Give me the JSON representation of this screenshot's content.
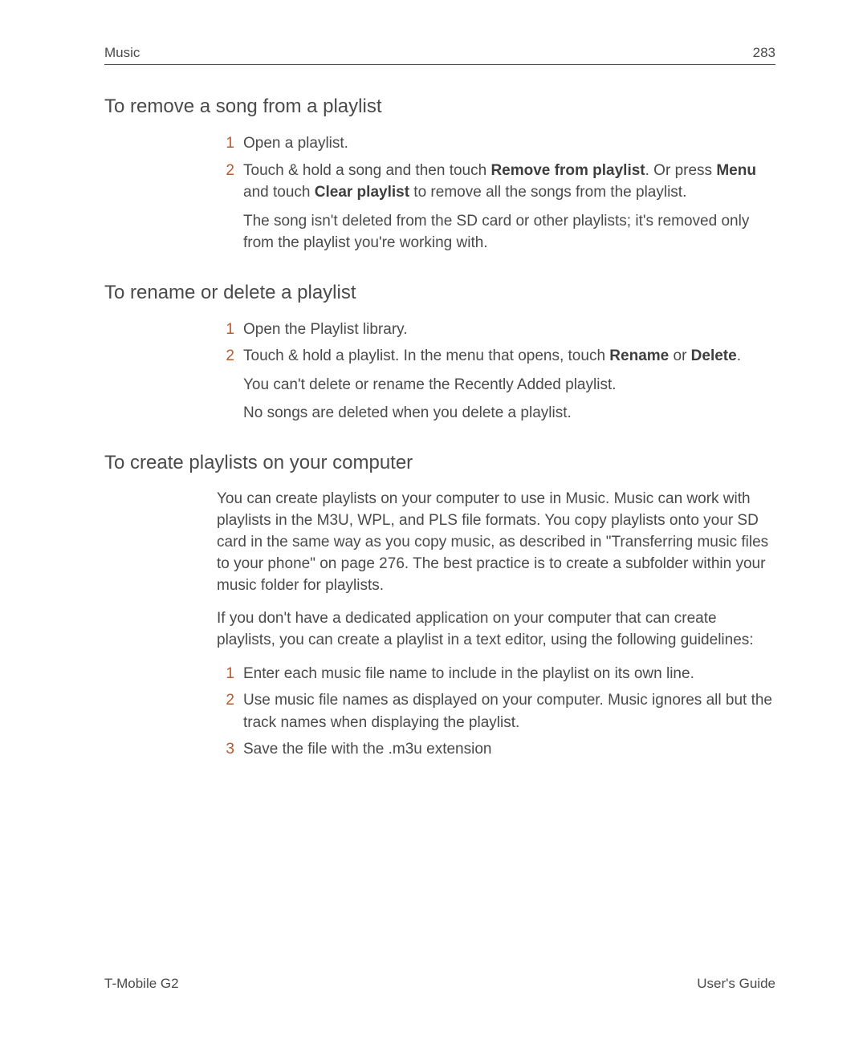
{
  "header": {
    "section": "Music",
    "page": "283"
  },
  "sections": [
    {
      "heading": "To remove a song from a playlist",
      "items": [
        {
          "num": "1",
          "html": "Open a playlist."
        },
        {
          "num": "2",
          "html": "Touch & hold a song and then touch <b>Remove from playlist</b>. Or press <b>Menu</b> and touch <b>Clear playlist</b> to remove all the songs from the playlist."
        }
      ],
      "notes": [
        "The song isn't deleted from the SD card or other playlists; it's removed only from the playlist you're working with."
      ]
    },
    {
      "heading": "To rename or delete a playlist",
      "items": [
        {
          "num": "1",
          "html": "Open the Playlist library."
        },
        {
          "num": "2",
          "html": "Touch & hold a playlist. In the menu that opens, touch <b>Rename</b> or <b>Delete</b>."
        }
      ],
      "notes": [
        "You can't delete or rename the Recently Added playlist.",
        "No songs are deleted when you delete a playlist."
      ]
    },
    {
      "heading": "To create playlists on your computer",
      "paras": [
        "You can create playlists on your computer to use in Music. Music can work with playlists in the M3U, WPL, and PLS file formats. You copy playlists onto your SD card in the same way as you copy music, as described in \"Transferring music files to your phone\" on page 276. The best practice is to create a subfolder within your music folder for playlists.",
        "If you don't have a dedicated application on your computer that can create playlists, you can create a playlist in a text editor, using the following guidelines:"
      ],
      "items": [
        {
          "num": "1",
          "html": "Enter each music file name to include in the playlist on its own line."
        },
        {
          "num": "2",
          "html": "Use music file names as displayed on your computer. Music ignores all but the track names when displaying the playlist."
        },
        {
          "num": "3",
          "html": "Save the file with the .m3u extension"
        }
      ]
    }
  ],
  "footer": {
    "left": "T-Mobile G2",
    "right": "User's Guide"
  }
}
